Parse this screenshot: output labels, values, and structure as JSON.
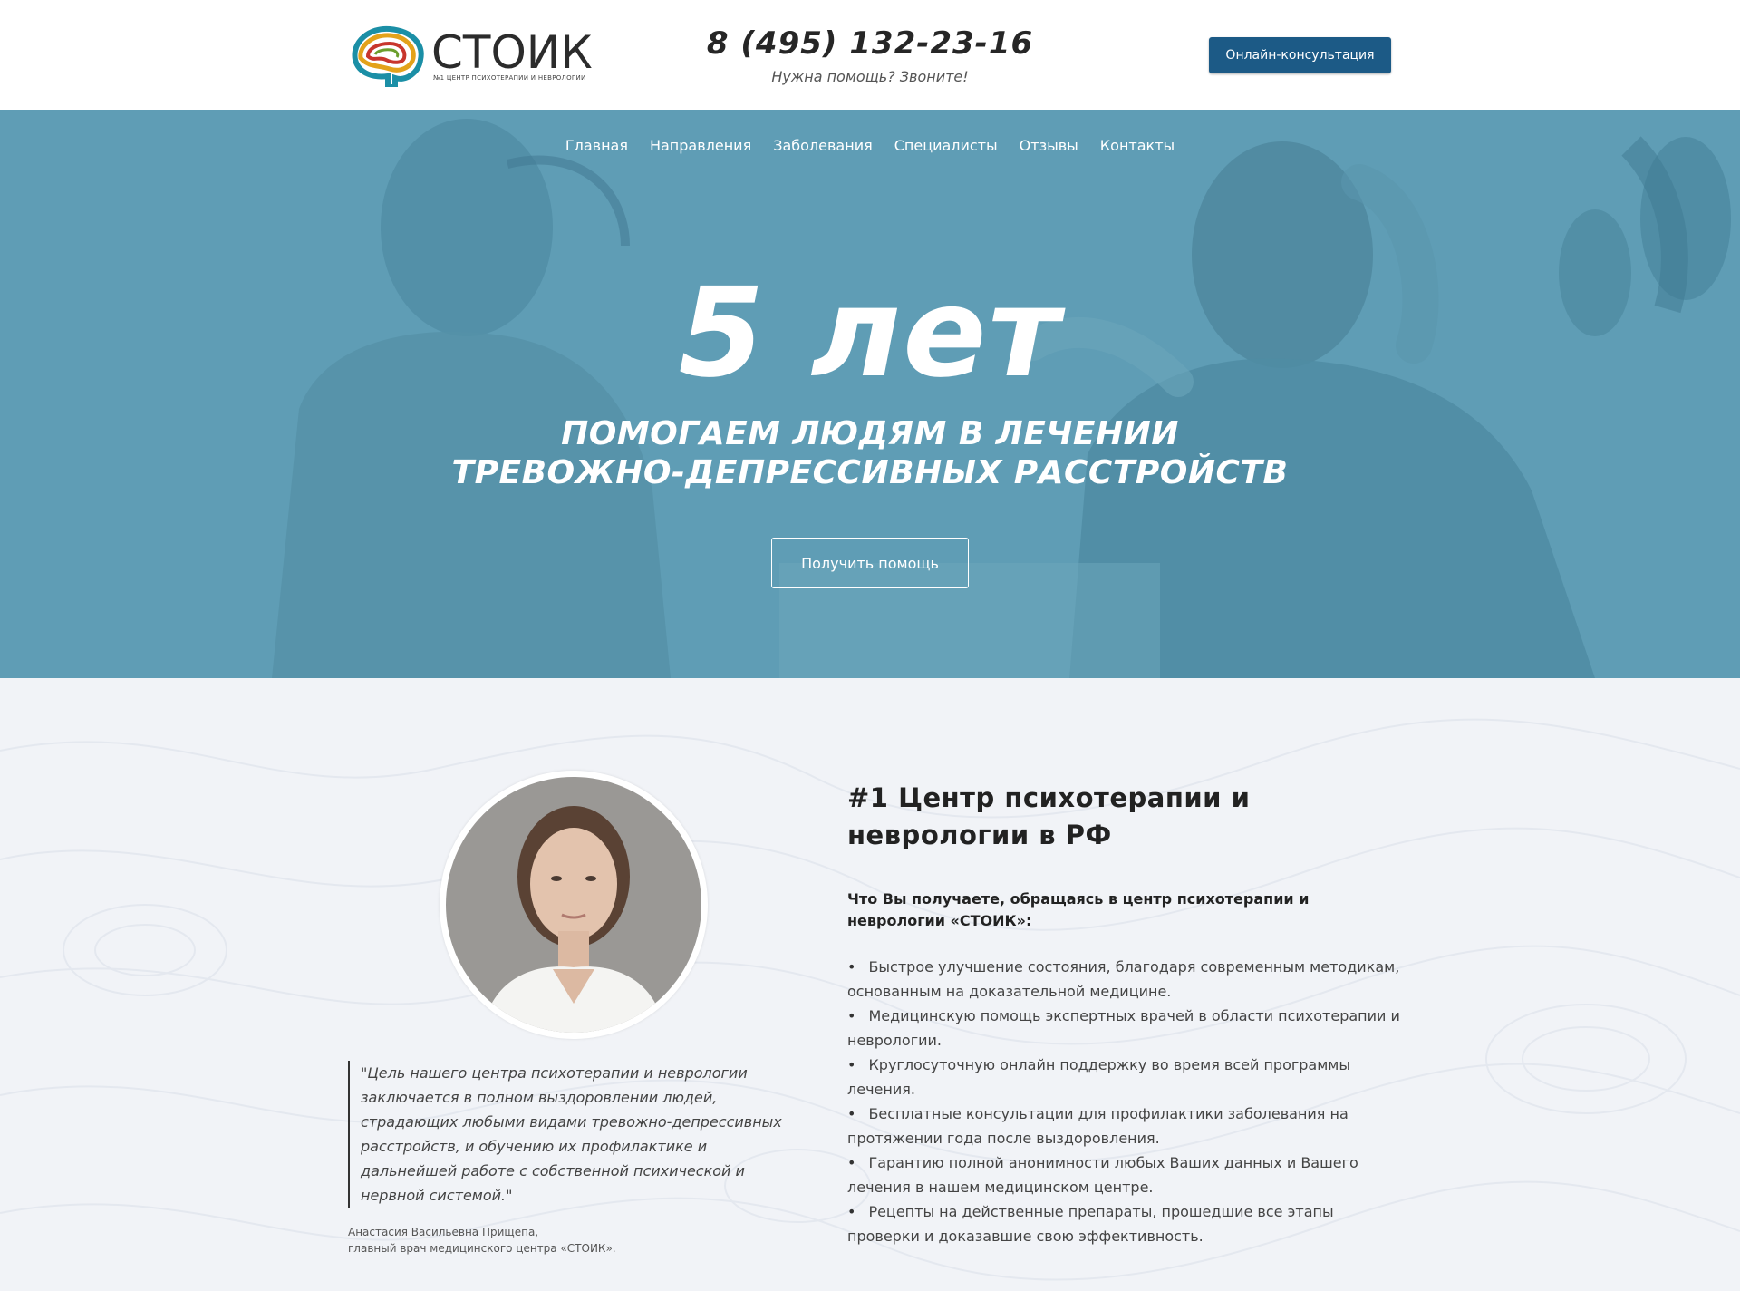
{
  "header": {
    "logo_name": "СТОИК",
    "logo_sub": "№1 ЦЕНТР ПСИХОТЕРАПИИ И НЕВРОЛОГИИ",
    "phone": "8 (495) 132-23-16",
    "phone_sub": "Нужна помощь? Звоните!",
    "consult_button": "Онлайн-консультация"
  },
  "nav": {
    "items": [
      "Главная",
      "Направления",
      "Заболевания",
      "Специалисты",
      "Отзывы",
      "Контакты"
    ]
  },
  "hero": {
    "title": "5 лет",
    "subtitle_line1": "ПОМОГАЕМ ЛЮДЯМ В ЛЕЧЕНИИ",
    "subtitle_line2": "ТРЕВОЖНО-ДЕПРЕССИВНЫХ РАССТРОЙСТВ",
    "button": "Получить помощь"
  },
  "about": {
    "title": "#1 Центр психотерапии и неврологии в РФ",
    "intro": "Что Вы получаете, обращаясь в центр психотерапии и неврологии «СТОИК»:",
    "benefits": [
      "Быстрое улучшение состояния, благодаря современным методикам, основанным на доказательной медицине.",
      "Медицинскую помощь экспертных врачей в области психотерапии и неврологии.",
      "Круглосуточную онлайн поддержку во время всей программы лечения.",
      "Бесплатные консультации для профилактики заболевания на протяжении года после выздоровления.",
      "Гарантию полной анонимности любых Ваших данных и Вашего лечения в нашем медицинском центре.",
      "Рецепты на действенные препараты, прошедшие все этапы проверки и доказавшие свою эффективность."
    ],
    "quote": "\"Цель нашего центра психотерапии и неврологии заключается в полном выздоровлении людей, страдающих любыми видами тревожно-депрессивных расстройств, и обучению их профилактике и дальнейшей работе с собственной психической и нервной системой.\"",
    "author_line1": "Анастасия Васильевна Прищепа,",
    "author_line2": "главный врач медицинского центра «СТОИК»."
  },
  "colors": {
    "consult_button_bg": "#1c5a86",
    "hero_overlay": "#5f9db5",
    "content_bg": "#f1f3f7"
  }
}
